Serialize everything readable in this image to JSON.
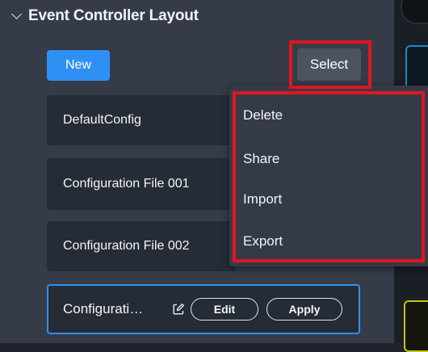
{
  "header": {
    "title": "Event Controller Layout",
    "collapse_icon": "chevron-down-icon"
  },
  "toolbar": {
    "new_label": "New",
    "select_label": "Select"
  },
  "configs": [
    {
      "label": "DefaultConfig"
    },
    {
      "label": "Configuration File 001"
    },
    {
      "label": "Configuration File 002"
    }
  ],
  "active_config": {
    "label": "Configurati…",
    "rename_icon": "edit-pencil-icon",
    "edit_label": "Edit",
    "apply_label": "Apply"
  },
  "select_menu": {
    "items": [
      {
        "label": "Delete"
      },
      {
        "label": "Share"
      },
      {
        "label": "Import"
      },
      {
        "label": "Export"
      }
    ]
  },
  "colors": {
    "accent": "#2f90f4",
    "highlight": "#e3141e",
    "panel": "#353c48",
    "item_bg": "#262c36"
  }
}
